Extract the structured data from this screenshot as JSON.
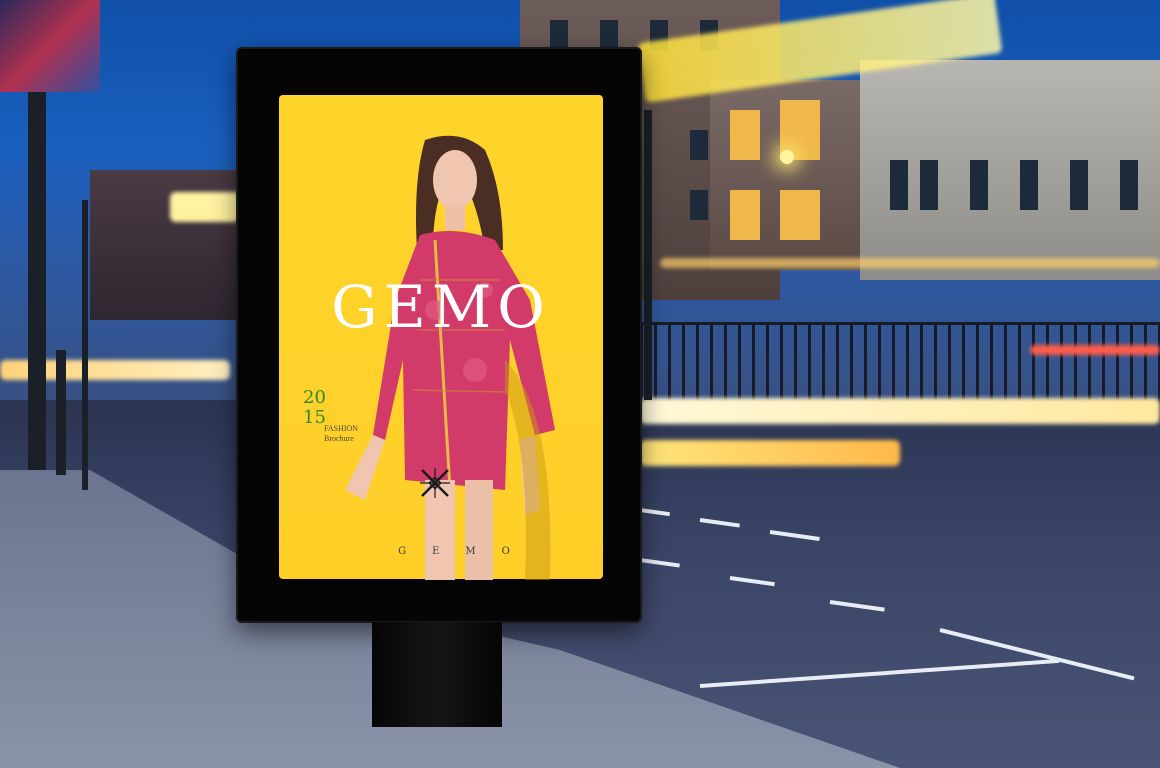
{
  "poster": {
    "brand": "GEMO",
    "year_line1": "20",
    "year_line2": "15",
    "tag_line1": "FASHION",
    "tag_line2": "Brochure",
    "footer_logo": "GEMO"
  },
  "colors": {
    "poster_background": "#ffd42a",
    "brand_text": "#ffffff",
    "year_text": "#2b8a2e",
    "dress": "#d23a6a",
    "frame": "#050505"
  },
  "icons": {
    "emblem": "crossed-pattern-emblem"
  }
}
